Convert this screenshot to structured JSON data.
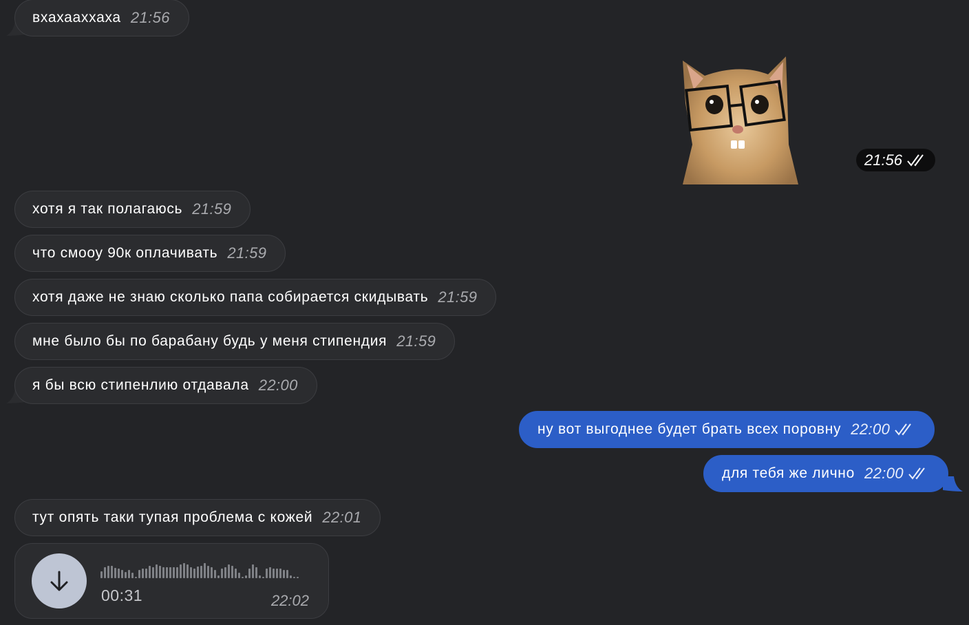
{
  "colors": {
    "background": "#232427",
    "incoming_bubble": "#2b2c2f",
    "outgoing_bubble": "#2c5ec7",
    "time_incoming": "#a9aaae",
    "voice_button": "#bec5d4"
  },
  "messages": {
    "m1": {
      "text": "вхахааххаха",
      "time": "21:56"
    },
    "sticker": {
      "time": "21:56",
      "icon": "cat-with-glasses-sticker"
    },
    "m2": {
      "text": "хотя я так полагаюсь",
      "time": "21:59"
    },
    "m3": {
      "text": "что смооу 90к оплачивать",
      "time": "21:59"
    },
    "m4": {
      "text": "хотя даже не знаю сколько папа собирается скидывать",
      "time": "21:59"
    },
    "m5": {
      "text": "мне было бы по барабану будь у меня стипендия",
      "time": "21:59"
    },
    "m6": {
      "text": "я бы всю стипенлию отдавала",
      "time": "22:00"
    },
    "o1": {
      "text": "ну вот выгоднее будет брать всех поровну",
      "time": "22:00",
      "status": "read"
    },
    "o2": {
      "text": "для тебя же лично",
      "time": "22:00",
      "status": "read"
    },
    "m7": {
      "text": "тут опять таки тупая проблема с кожей",
      "time": "22:01"
    },
    "voice": {
      "duration": "00:31",
      "time": "22:02",
      "icon": "download-arrow-icon"
    }
  }
}
